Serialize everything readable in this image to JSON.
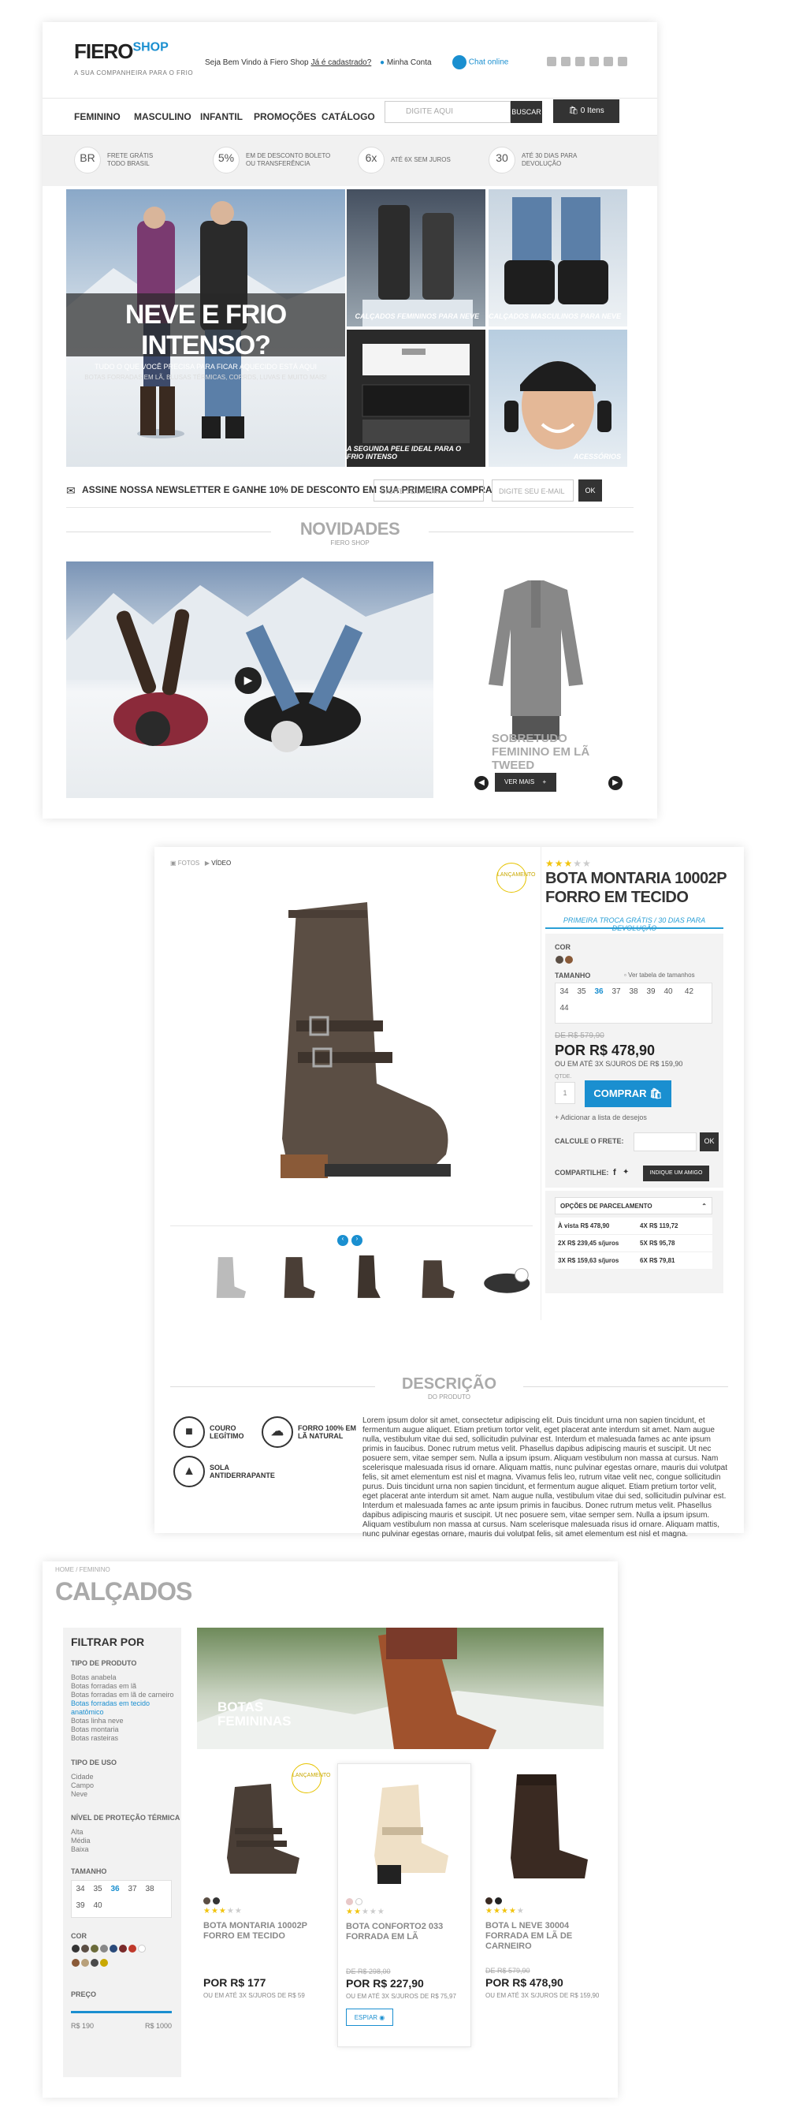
{
  "header": {
    "logo": "FIERO",
    "logo_shop": "SHOP",
    "tagline": "A SUA COMPANHEIRA PARA O FRIO",
    "welcome": "Seja Bem Vindo à Fiero Shop",
    "signup": "Já é cadastrado?",
    "account": "Minha Conta",
    "chat": "Chat online"
  },
  "nav": {
    "items": [
      "FEMININO",
      "MASCULINO",
      "INFANTIL",
      "PROMOÇÕES",
      "CATÁLOGO"
    ],
    "search_placeholder": "DIGITE AQUI",
    "search_button": "BUSCAR",
    "cart": "0 Itens"
  },
  "benefits": [
    {
      "icon": "BR",
      "text": "FRETE GRÁTIS TODO BRASIL"
    },
    {
      "icon": "5%",
      "text": "EM DE DESCONTO BOLETO OU TRANSFERÊNCIA"
    },
    {
      "icon": "6x",
      "text": "ATÉ 6X SEM JUROS"
    },
    {
      "icon": "30",
      "text": "ATÉ 30 DIAS PARA DEVOLUÇÃO"
    }
  ],
  "hero": {
    "title": "NEVE E FRIO INTENSO?",
    "subtitle": "TUDO O QUE VOCÊ PRECISA PARA FICAR AQUECIDO ESTÁ AQUI",
    "details": "BOTAS FORRADAS EM LÃ, BLUSAS TÉRMICAS, CORRDS, LUVAS E MUITO MAIS!"
  },
  "tiles": [
    "CALÇADOS FEMININOS PARA NEVE",
    "CALÇADOS MASCULINOS PARA NEVE",
    "A SEGUNDA PELE IDEAL PARA O FRIO INTENSO",
    "ACESSÓRIOS"
  ],
  "newsletter": {
    "text": "ASSINE NOSSA NEWSLETTER E GANHE 10% DE DESCONTO EM SUA PRIMEIRA COMPRA",
    "name_placeholder": "DIGITE SEU NOME",
    "email_placeholder": "DIGITE SEU E-MAIL",
    "button": "OK"
  },
  "novidades": {
    "title": "NOVIDADES",
    "subtitle": "FIERO SHOP",
    "product_title": "SOBRETUDO FEMININO EM LÃ TWEED",
    "more": "VER MAIS"
  },
  "product": {
    "menu_photos": "FOTOS",
    "menu_video": "VÍDEO",
    "badge": "LANÇAMENTO",
    "title": "BOTA MONTARIA 10002P FORRO EM TECIDO",
    "promo": "PRIMEIRA TROCA GRÁTIS / 30 DIAS PARA DEVOLUÇÃO",
    "color_label": "COR",
    "size_label": "TAMANHO",
    "size_table": "Ver tabela de tamanhos",
    "sizes": [
      "34",
      "35",
      "36",
      "37",
      "38",
      "39",
      "40",
      "42",
      "44"
    ],
    "old_price": "DE R$ 579,90",
    "price": "POR R$ 478,90",
    "installments": "OU EM ATÉ 3X S/JUROS DE R$ 159,90",
    "qty_label": "QTDE.",
    "qty": "1",
    "buy": "COMPRAR",
    "wishlist": "+ Adicionar a lista de desejos",
    "shipping_label": "CALCULE O FRETE:",
    "shipping_button": "OK",
    "share_label": "COMPARTILHE:",
    "indicate": "INDIQUE UM AMIGO",
    "installments_title": "OPÇÕES DE PARCELAMENTO",
    "installment_rows": [
      [
        "À vista R$ 478,90",
        "4X R$ 119,72"
      ],
      [
        "2X R$ 239,45 s/juros",
        "5X R$ 95,78"
      ],
      [
        "3X R$ 159,63 s/juros",
        "6X R$ 79,81"
      ]
    ],
    "desc_title": "DESCRIÇÃO",
    "desc_sub": "DO PRODUTO",
    "features": [
      "COURO LEGÍTIMO",
      "FORRO 100% EM LÃ NATURAL",
      "SOLA ANTIDERRAPANTE"
    ],
    "description": "Lorem ipsum dolor sit amet, consectetur adipiscing elit. Duis tincidunt urna non sapien tincidunt, et fermentum augue aliquet. Etiam pretium tortor velit, eget placerat ante interdum sit amet. Nam augue nulla, vestibulum vitae dui sed, sollicitudin pulvinar est. Interdum et malesuada fames ac ante ipsum primis in faucibus. Donec rutrum metus velit. Phasellus dapibus adipiscing mauris et suscipit. Ut nec posuere sem, vitae semper sem. Nulla a ipsum ipsum. Aliquam vestibulum non massa at cursus. Nam scelerisque malesuada risus id ornare. Aliquam mattis, nunc pulvinar egestas ornare, mauris dui volutpat felis, sit amet elementum est nisl et magna. Vivamus felis leo, rutrum vitae velit nec, congue sollicitudin purus. Duis tincidunt urna non sapien tincidunt, et fermentum augue aliquet. Etiam pretium tortor velit, eget placerat ante interdum sit amet. Nam augue nulla, vestibulum vitae dui sed, sollicitudin pulvinar est. Interdum et malesuada fames ac ante ipsum primis in faucibus. Donec rutrum metus velit. Phasellus dapibus adipiscing mauris et suscipit. Ut nec posuere sem, vitae semper sem. Nulla a ipsum ipsum. Aliquam vestibulum non massa at cursus. Nam scelerisque malesuada risus id ornare. Aliquam mattis, nunc pulvinar egestas ornare, mauris dui volutpat felis, sit amet elementum est nisl et magna."
  },
  "category": {
    "breadcrumb": "HOME / FEMININO",
    "title": "CALÇADOS",
    "filter_title": "FILTRAR POR",
    "product_type_label": "TIPO DE PRODUTO",
    "product_types": [
      "Botas anabela",
      "Botas forradas em lã",
      "Botas forradas em lã de carneiro",
      "Botas forradas em tecido anatômico",
      "Botas linha neve",
      "Botas montaria",
      "Botas rasteiras"
    ],
    "use_label": "TIPO DE USO",
    "uses": [
      "Cidade",
      "Campo",
      "Neve"
    ],
    "protection_label": "NÍVEL DE PROTEÇÃO TÉRMICA",
    "protections": [
      "Alta",
      "Média",
      "Baixa"
    ],
    "size_label": "TAMANHO",
    "sizes": [
      "34",
      "35",
      "36",
      "37",
      "38",
      "39",
      "40"
    ],
    "color_label": "COR",
    "price_label": "PREÇO",
    "price_min": "R$ 190",
    "price_max": "R$ 1000",
    "banner": "BOTAS FEMININAS",
    "badge": "LANÇAMENTO",
    "compare": "ESPIAR",
    "products": [
      {
        "name": "BOTA MONTARIA 10002P FORRO EM TECIDO",
        "old": "",
        "price": "POR R$ 177",
        "inst": "OU EM ATÉ 3X S/JUROS DE R$ 59"
      },
      {
        "name": "BOTA CONFORTO2 033 FORRADA EM LÃ",
        "old": "DE R$ 298,00",
        "price": "POR R$ 227,90",
        "inst": "OU EM ATÉ 3X S/JUROS DE R$ 75,97"
      },
      {
        "name": "BOTA L NEVE 30004 FORRADA EM LÃ DE CARNEIRO",
        "old": "DE R$ 579,90",
        "price": "POR R$ 478,90",
        "inst": "OU EM ATÉ 3X S/JUROS DE R$ 159,90"
      }
    ]
  },
  "colors": {
    "accent": "#1a8fd0",
    "dark": "#333333",
    "star": "#f1c40f"
  }
}
